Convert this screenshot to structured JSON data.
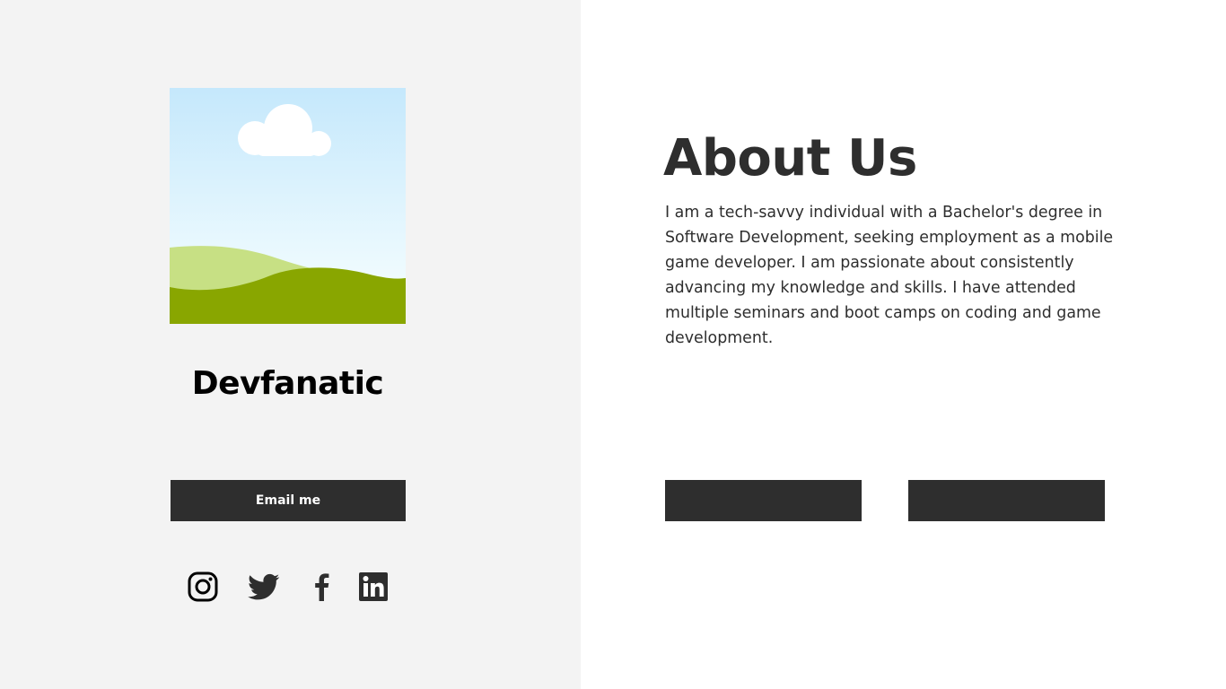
{
  "profile": {
    "image_icon": "landscape-placeholder-icon",
    "name": "Devfanatic",
    "email_button_label": "Email me"
  },
  "social": [
    {
      "name": "instagram-icon"
    },
    {
      "name": "twitter-icon"
    },
    {
      "name": "facebook-icon"
    },
    {
      "name": "linkedin-icon"
    }
  ],
  "about": {
    "title": "About Us",
    "body": "I am a tech-savvy individual with a Bachelor's degree in Software Development, seeking employment as a mobile game developer. I am passionate about consistently advancing my knowledge and skills. I have attended multiple seminars and boot camps on coding and game development.",
    "button_1_label": "",
    "button_2_label": ""
  },
  "colors": {
    "left_panel_bg": "#f3f3f3",
    "page_bg": "#ffffff",
    "button_bg": "#2e2e2e",
    "text_dark": "#2e2e2e"
  }
}
